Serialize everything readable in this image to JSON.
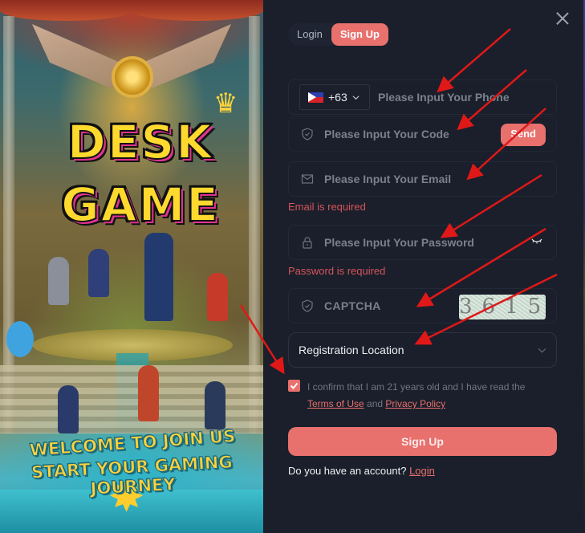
{
  "art": {
    "title_line1": "DESK",
    "title_line2": "GAME",
    "banner_line1": "WELCOME TO JOIN US",
    "banner_line2": "START YOUR GAMING JOURNEY",
    "crown_glyph": "♛",
    "star_glyph": "✸"
  },
  "modal": {
    "close_icon": "close-icon",
    "tabs": [
      {
        "label": "Login",
        "active": false
      },
      {
        "label": "Sign Up",
        "active": true
      }
    ],
    "phone": {
      "country_flag": "philippines-flag",
      "country_code": "+63",
      "placeholder": "Please Input Your Phone"
    },
    "code": {
      "icon": "shield-check-icon",
      "placeholder": "Please Input Your Code",
      "send_label": "Send"
    },
    "email": {
      "icon": "envelope-icon",
      "placeholder": "Please Input Your Email",
      "error": "Email is required"
    },
    "password": {
      "icon": "lock-icon",
      "placeholder": "Please Input Your Password",
      "toggle_icon": "eye-closed-icon",
      "error": "Password is required"
    },
    "captcha": {
      "icon": "shield-check-icon",
      "placeholder": "CAPTCHA",
      "image_text": "3615"
    },
    "location": {
      "value": "Registration Location"
    },
    "agreement": {
      "checked": true,
      "text_before": "I confirm that I am 21 years old and I have read the ",
      "terms_link": "Terms of Use",
      "text_middle": " and ",
      "privacy_link": "Privacy Policy"
    },
    "submit_label": "Sign Up",
    "footer": {
      "question": "Do you have an account? ",
      "login_link": "Login"
    }
  },
  "colors": {
    "accent": "#e8706d",
    "background": "#1a1f2b",
    "error": "#d6545a",
    "annotation_arrow": "#e01818"
  }
}
